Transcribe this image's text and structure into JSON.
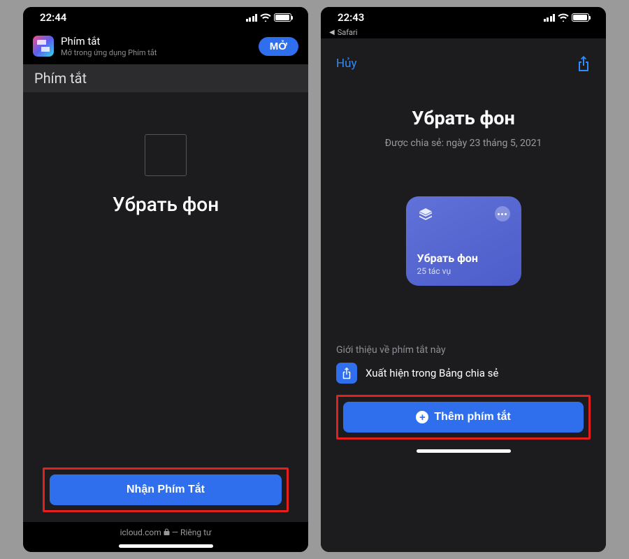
{
  "left": {
    "status": {
      "time": "22:44"
    },
    "banner": {
      "title": "Phím tắt",
      "subtitle": "Mở trong ứng dụng Phím tắt",
      "open_label": "MỞ"
    },
    "section_header": "Phím tắt",
    "shortcut_name": "Убрать фон",
    "get_button_label": "Nhận Phím Tắt",
    "footer": {
      "domain": "icloud.com",
      "privacy": "— Riêng tư"
    }
  },
  "right": {
    "status": {
      "time": "22:43"
    },
    "breadcrumb": "Safari",
    "sheet": {
      "cancel_label": "Hủy",
      "title": "Убрать фон",
      "shared_text": "Được chia sẻ: ngày 23 tháng 5, 2021",
      "card": {
        "title": "Убрать фон",
        "subtitle": "25 tác vụ"
      },
      "intro_label": "Giới thiệu về phím tắt này",
      "share_row_text": "Xuất hiện trong Bảng chia sẻ",
      "add_button_label": "Thêm phím tắt"
    }
  }
}
